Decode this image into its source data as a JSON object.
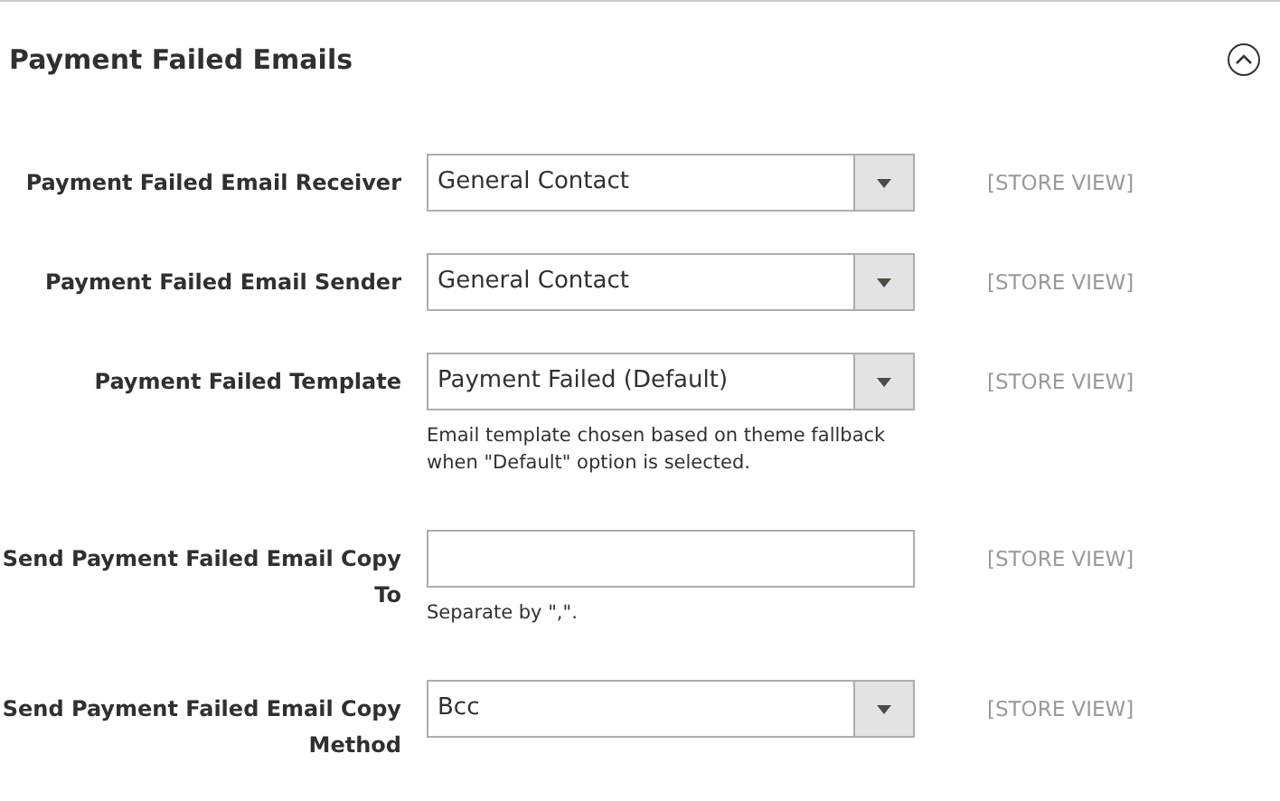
{
  "section": {
    "title": "Payment Failed Emails",
    "expanded": true
  },
  "fields": [
    {
      "kind": "select",
      "label": "Payment Failed Email Receiver",
      "value": "General Contact",
      "scope": "[STORE VIEW]"
    },
    {
      "kind": "select",
      "label": "Payment Failed Email Sender",
      "value": "General Contact",
      "scope": "[STORE VIEW]"
    },
    {
      "kind": "select",
      "label": "Payment Failed Template",
      "value": "Payment Failed (Default)",
      "note": "Email template chosen based on theme fallback when \"Default\" option is selected.",
      "scope": "[STORE VIEW]"
    },
    {
      "kind": "text",
      "label": "Send Payment Failed Email Copy To",
      "note": "Separate by \",\".",
      "scope": "[STORE VIEW]"
    },
    {
      "kind": "select",
      "label": "Send Payment Failed Email Copy Method",
      "value": "Bcc",
      "scope": "[STORE VIEW]"
    }
  ]
}
